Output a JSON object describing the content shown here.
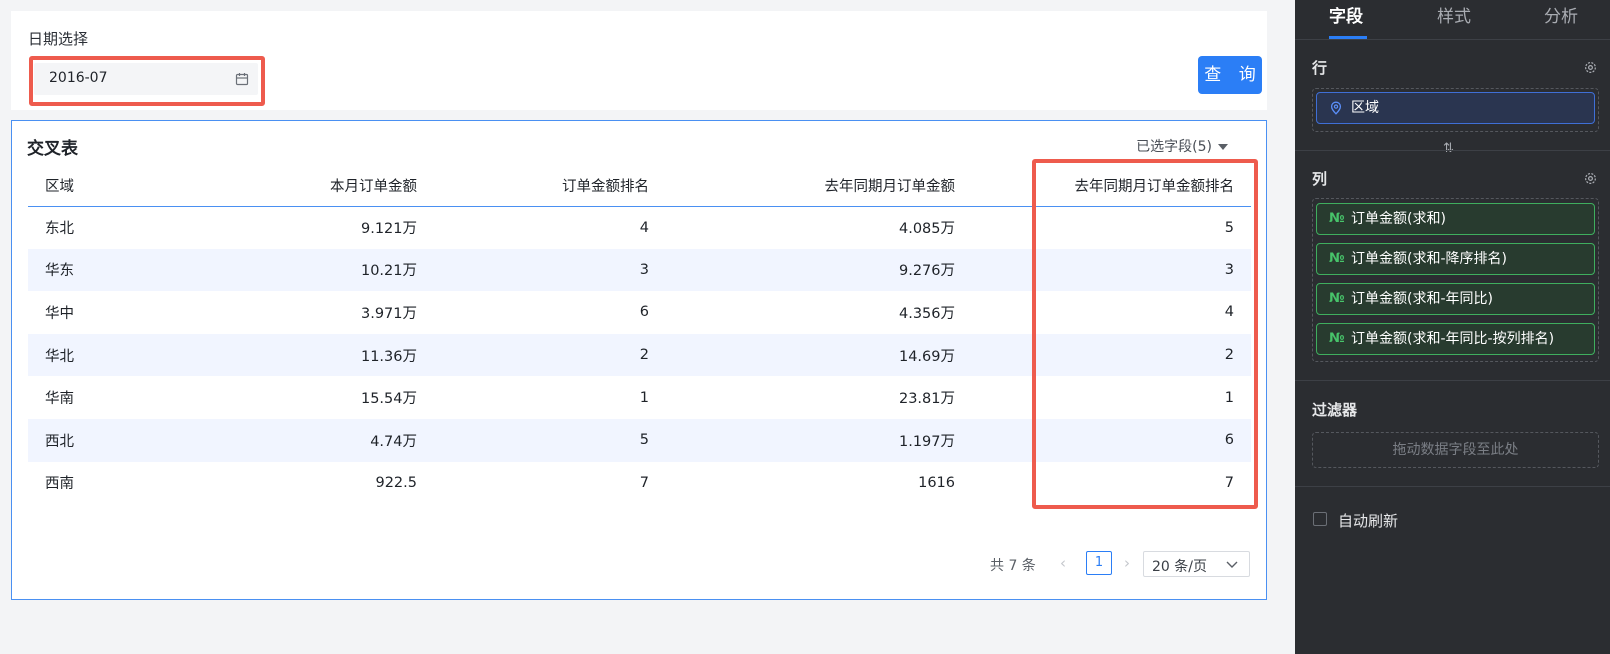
{
  "filter": {
    "label": "日期选择",
    "date_value": "2016-07",
    "query_button": "查 询"
  },
  "table": {
    "title": "交叉表",
    "selected_fields": "已选字段(5)",
    "columns": [
      "区域",
      "本月订单金额",
      "订单金额排名",
      "去年同期月订单金额",
      "去年同期月订单金额排名"
    ],
    "rows": [
      [
        "东北",
        "9.121万",
        "4",
        "4.085万",
        "5"
      ],
      [
        "华东",
        "10.21万",
        "3",
        "9.276万",
        "3"
      ],
      [
        "华中",
        "3.971万",
        "6",
        "4.356万",
        "4"
      ],
      [
        "华北",
        "11.36万",
        "2",
        "14.69万",
        "2"
      ],
      [
        "华南",
        "15.54万",
        "1",
        "23.81万",
        "1"
      ],
      [
        "西北",
        "4.74万",
        "5",
        "1.197万",
        "6"
      ],
      [
        "西南",
        "922.5",
        "7",
        "1616",
        "7"
      ]
    ],
    "pagination": {
      "total": "共 7 条",
      "current_page": "1",
      "page_size": "20 条/页"
    }
  },
  "panel": {
    "tabs": [
      "字段",
      "样式",
      "分析"
    ],
    "active_tab": "字段",
    "row_section": {
      "title": "行",
      "fields": [
        "区域"
      ]
    },
    "column_section": {
      "title": "列",
      "fields": [
        "订单金额(求和)",
        "订单金额(求和-降序排名)",
        "订单金额(求和-年同比)",
        "订单金额(求和-年同比-按列排名)"
      ]
    },
    "filter_section": {
      "title": "过滤器",
      "placeholder": "拖动数据字段至此处"
    },
    "auto_refresh": {
      "label": "自动刷新",
      "checked": false
    }
  },
  "colors": {
    "accent": "#2b7ef6",
    "highlight_border": "#ee5b4d",
    "panel_bg": "#2b2d31",
    "row_stripe": "#f1f5ff"
  },
  "icons": {
    "date_picker": "calendar-icon",
    "row_field": "location-pin-icon",
    "column_field": "number-icon",
    "section_settings": "gear-icon",
    "swap": "swap-vertical-icon",
    "page_size": "chevron-down-icon"
  }
}
